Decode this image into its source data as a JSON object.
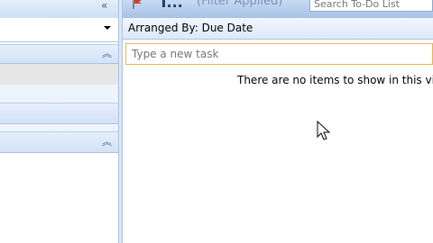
{
  "toolbar": {
    "title": "T...",
    "filter_status": "(Filter Applied)",
    "search_placeholder": "Search To-Do List",
    "collapse_icon": "double-chevron-left-icon",
    "app_icon": "flag-icon"
  },
  "view": {
    "arranged_by": "Arranged By: Due Date",
    "new_task_placeholder": "Type a new task",
    "empty_message": "There are no items to show in this view."
  },
  "nav_pane": {
    "expand_icon": "double-chevron-up-icon",
    "dropdown_icon": "chevron-down-icon"
  },
  "colors": {
    "accent": "#a9c2e4",
    "header": "#1f3f6f",
    "new_task_border": "#e8b64f"
  }
}
